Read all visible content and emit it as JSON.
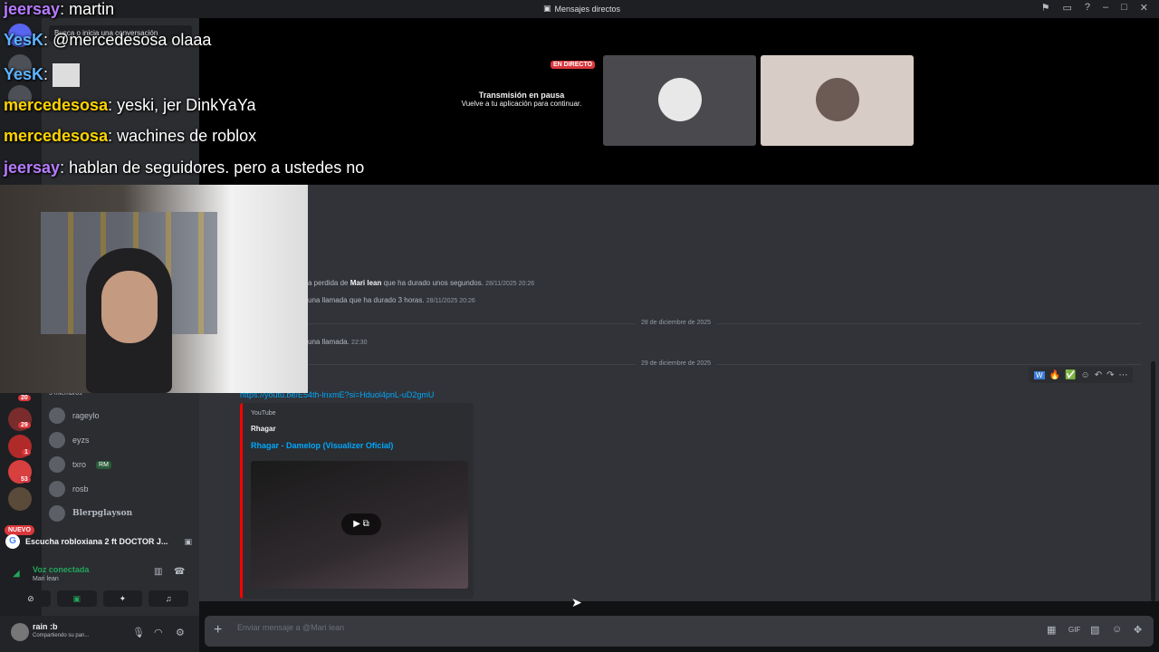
{
  "window": {
    "title": "Mensajes directos"
  },
  "sidebar": {
    "search_placeholder": "Busca o inicia una conversación",
    "members": [
      {
        "name": "rageylo"
      },
      {
        "name": "eyzs"
      },
      {
        "name": "txro",
        "tag": "RM"
      },
      {
        "name": "rosb"
      },
      {
        "name": "Blerpglayson"
      }
    ],
    "group_count": "5 miembros",
    "nuevo_label": "NUEVO",
    "badges": [
      "20",
      "29",
      "1",
      "53"
    ]
  },
  "activity": {
    "text": "Escucha robloxiana 2 ft DOCTOR J..."
  },
  "voice": {
    "status": "Voz conectada",
    "channel": "Mari lean"
  },
  "user": {
    "name": "rain :b",
    "status": "Compartiendo su pan..."
  },
  "stream": {
    "live_label": "EN DIRECTO",
    "paused_title": "Transmisión en pausa",
    "paused_sub": "Vuelve a tu aplicación para continuar."
  },
  "chat": {
    "lines": [
      {
        "pre": "a perdida de ",
        "who": "Mari lean",
        "post": " que ha durado unos segundos.",
        "ts": "28/11/2025 20:26"
      },
      {
        "pre": "una llamada que ha durado 3 horas.",
        "who": "",
        "post": "",
        "ts": "28/11/2025 20:26"
      },
      {
        "pre": "una llamada.",
        "who": "",
        "post": "",
        "ts": "22:30"
      }
    ],
    "date1": "28 de diciembre de 2025",
    "date2": "29 de diciembre de 2025",
    "link": "https://youtu.be/E54th-lnxmE?si=Hduol4pnL-uD2gmU",
    "embed": {
      "provider": "YouTube",
      "author": "Rhagar",
      "title": "Rhagar - Damelop (Visualizer Oficial)"
    }
  },
  "composer": {
    "placeholder": "Enviar mensaje a @Mari lean"
  },
  "overlay_chat": [
    {
      "user": "jeersay",
      "color": "#b77cff",
      "text": "martin"
    },
    {
      "user": "YesK",
      "color": "#5fb3ff",
      "text": "@mercedesosa olaaa"
    },
    {
      "user": "YesK",
      "color": "#5fb3ff",
      "text": ""
    },
    {
      "user": "mercedesosa",
      "color": "#ffd400",
      "text": "yeski, jer DinkYaYa"
    },
    {
      "user": "mercedesosa",
      "color": "#ffd400",
      "text": "wachines de roblox"
    },
    {
      "user": "jeersay",
      "color": "#b77cff",
      "text": "hablan de seguidores. pero a ustedes no"
    }
  ],
  "colors": {
    "accent": "#00a8fc",
    "live": "#da373c",
    "online": "#23a55a",
    "youtube": "#ff0000"
  },
  "icons": [
    "discord-icon",
    "flag-icon",
    "screen-icon",
    "help-icon",
    "minimize-icon",
    "maximize-icon",
    "close-icon",
    "play-icon",
    "plus-icon",
    "gift-icon",
    "gif-icon",
    "sticker-icon",
    "emoji-icon",
    "apps-icon",
    "mic-icon",
    "headphones-icon",
    "gear-icon"
  ]
}
